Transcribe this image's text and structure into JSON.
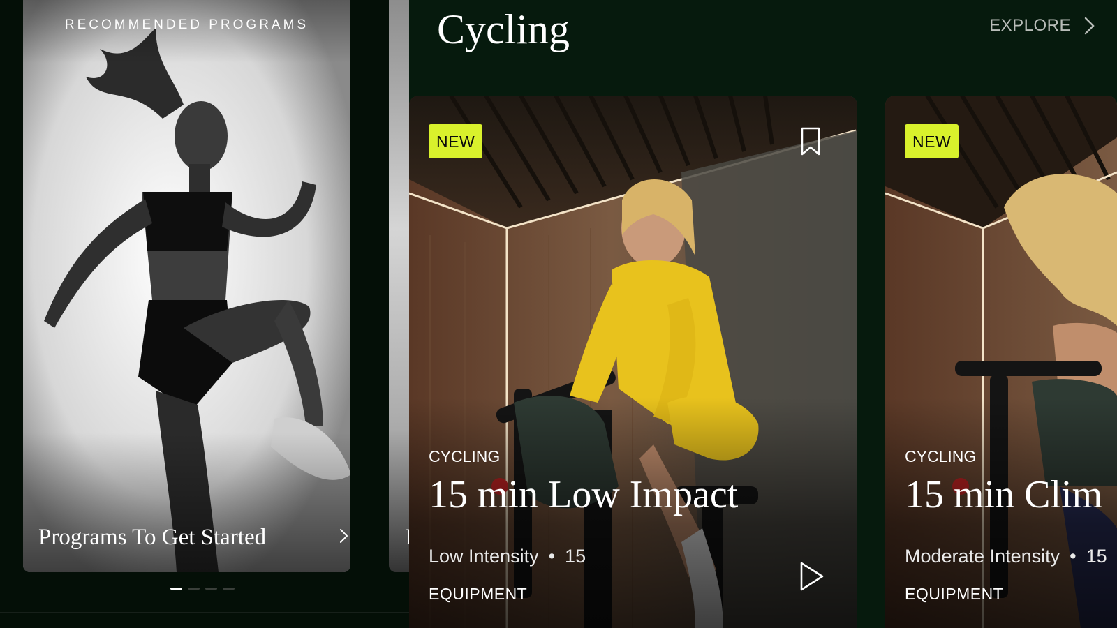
{
  "programs": {
    "heading": "RECOMMENDED PROGRAMS",
    "card_title": "Programs To Get Started",
    "next_card_initial": "I",
    "pagination": {
      "total": 4,
      "active": 1
    }
  },
  "cycling": {
    "title": "Cycling",
    "explore_label": "EXPLORE",
    "cards": [
      {
        "badge": "NEW",
        "category": "CYCLING",
        "title": "15 min Low Impact",
        "intensity": "Low Intensity",
        "separator": "•",
        "duration": "15",
        "equipment": "EQUIPMENT"
      },
      {
        "badge": "NEW",
        "category": "CYCLING",
        "title": "15 min Clim",
        "intensity": "Moderate Intensity",
        "separator": "•",
        "duration": "15",
        "equipment": "EQUIPMENT"
      }
    ]
  },
  "colors": {
    "background": "#061a0d",
    "badge": "#d9f12c",
    "outfit": "#e8c21d"
  },
  "icons": {
    "explore": "chevron-right-icon",
    "program": "chevron-right-icon",
    "save": "bookmark-icon",
    "start": "play-icon"
  }
}
